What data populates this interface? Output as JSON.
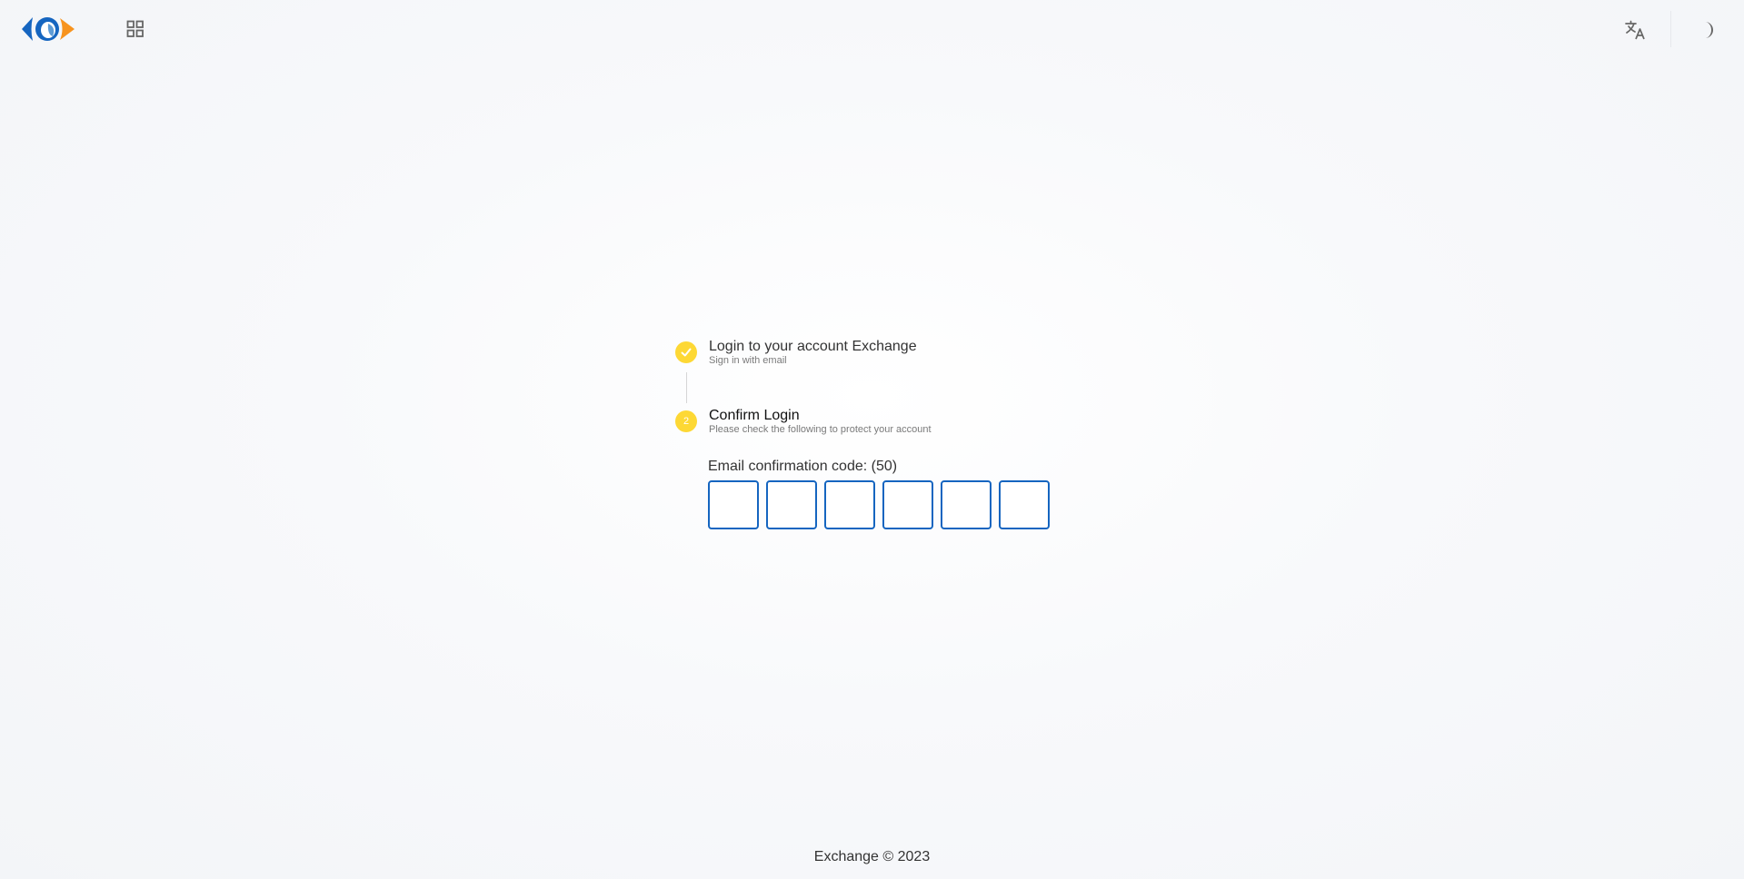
{
  "header": {
    "logo_icon": "eye-logo-icon",
    "apps_icon": "grid-apps-icon",
    "translate_icon": "translate-icon",
    "theme_icon": "moon-icon"
  },
  "steps": [
    {
      "title": "Login to your account Exchange",
      "subtitle": "Sign in with email",
      "status": "completed",
      "icon": "check-icon"
    },
    {
      "number": "2",
      "title": "Confirm Login",
      "subtitle": "Please check the following to protect your account",
      "status": "active"
    }
  ],
  "confirmation": {
    "label": "Email confirmation code: (50)",
    "digits": [
      "",
      "",
      "",
      "",
      "",
      ""
    ]
  },
  "footer": {
    "text": "Exchange © 2023"
  },
  "colors": {
    "step_accent": "#fdd835",
    "input_border": "#1565c0",
    "logo_blue": "#1565c0",
    "logo_orange": "#f7931e"
  }
}
